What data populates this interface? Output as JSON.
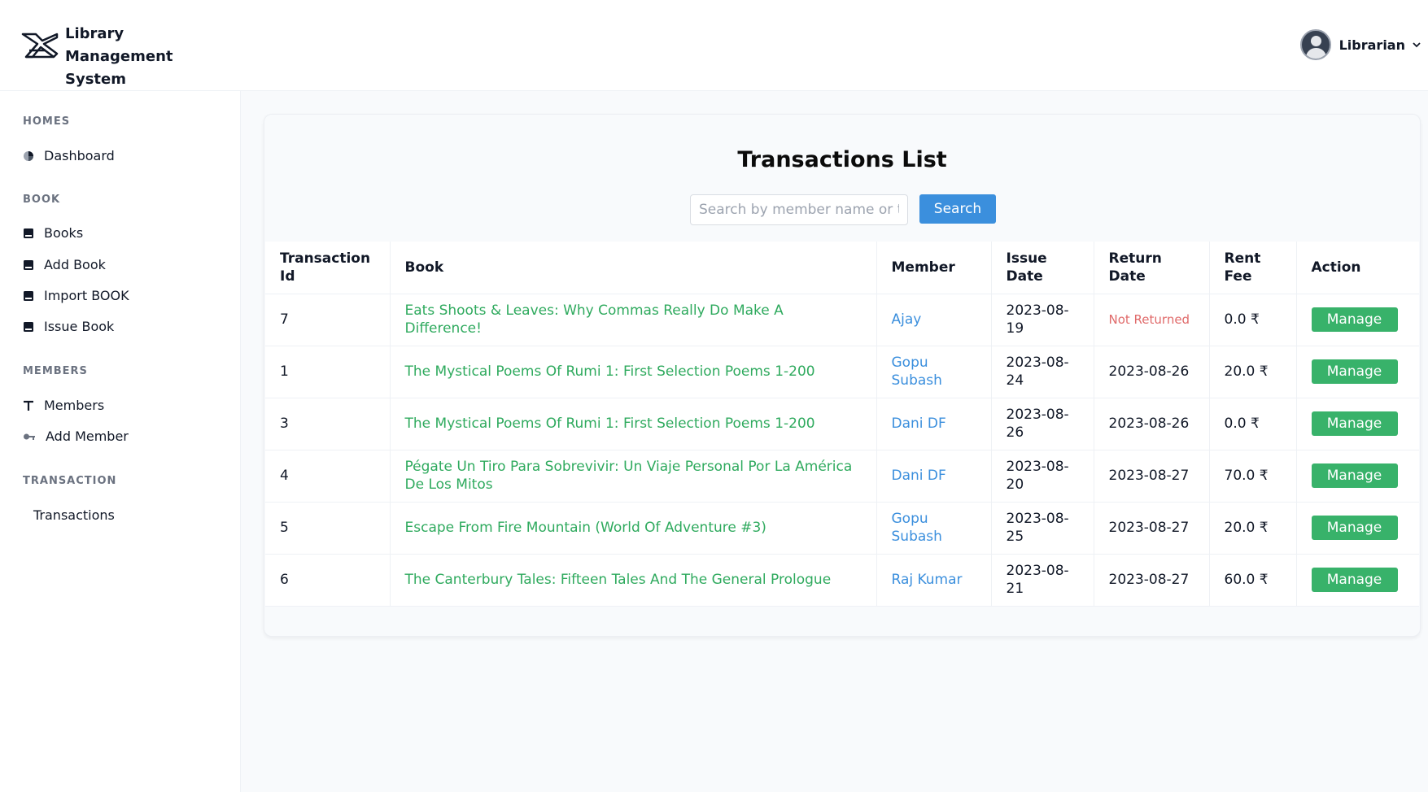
{
  "header": {
    "title": "Library Management System",
    "title_line1": "Library Management",
    "title_line2": "System",
    "logo_icon": "library-logo-icon",
    "user": {
      "name": "Librarian",
      "avatar_icon": "user-avatar-icon",
      "dropdown_icon": "chevron-down-icon"
    }
  },
  "sidebar": {
    "sections": [
      {
        "title": "HOMES",
        "items": [
          {
            "label": "Dashboard",
            "icon": "pie-chart-icon"
          }
        ]
      },
      {
        "title": "BOOK",
        "items": [
          {
            "label": "Books",
            "icon": "book-icon"
          },
          {
            "label": "Add Book",
            "icon": "book-icon"
          },
          {
            "label": "Import BOOK",
            "icon": "book-icon"
          },
          {
            "label": "Issue Book",
            "icon": "book-icon"
          }
        ]
      },
      {
        "title": "MEMBERS",
        "items": [
          {
            "label": "Members",
            "icon": "text-t-icon"
          },
          {
            "label": "Add Member",
            "icon": "key-icon"
          }
        ]
      },
      {
        "title": "TRANSACTION",
        "items": [
          {
            "label": "Transactions",
            "icon": ""
          }
        ]
      }
    ]
  },
  "main": {
    "title": "Transactions List",
    "search": {
      "placeholder": "Search by member name or tr",
      "button_label": "Search"
    },
    "table": {
      "headers": [
        "Transaction Id",
        "Book",
        "Member",
        "Issue Date",
        "Return Date",
        "Rent Fee",
        "Action"
      ],
      "rows": [
        {
          "id": "7",
          "book": "Eats Shoots & Leaves: Why Commas Really Do Make A Difference!",
          "member": "Ajay",
          "issue_date": "2023-08-19",
          "return_date": "Not Returned",
          "rent_fee": "0.0 ₹",
          "action": "Manage"
        },
        {
          "id": "1",
          "book": "The Mystical Poems Of Rumi 1: First Selection Poems 1-200",
          "member": "Gopu Subash",
          "issue_date": "2023-08-24",
          "return_date": "2023-08-26",
          "rent_fee": "20.0 ₹",
          "action": "Manage"
        },
        {
          "id": "3",
          "book": "The Mystical Poems Of Rumi 1: First Selection Poems 1-200",
          "member": "Dani DF",
          "issue_date": "2023-08-26",
          "return_date": "2023-08-26",
          "rent_fee": "0.0 ₹",
          "action": "Manage"
        },
        {
          "id": "4",
          "book": "Pégate Un Tiro Para Sobrevivir: Un Viaje Personal Por La América De Los Mitos",
          "member": "Dani DF",
          "issue_date": "2023-08-20",
          "return_date": "2023-08-27",
          "rent_fee": "70.0 ₹",
          "action": "Manage"
        },
        {
          "id": "5",
          "book": "Escape From Fire Mountain (World Of Adventure #3)",
          "member": "Gopu Subash",
          "issue_date": "2023-08-25",
          "return_date": "2023-08-27",
          "rent_fee": "20.0 ₹",
          "action": "Manage"
        },
        {
          "id": "6",
          "book": "The Canterbury Tales: Fifteen Tales And The General Prologue",
          "member": "Raj Kumar",
          "issue_date": "2023-08-21",
          "return_date": "2023-08-27",
          "rent_fee": "60.0 ₹",
          "action": "Manage"
        }
      ]
    }
  },
  "colors": {
    "accent_blue": "#3b8fdd",
    "book_green": "#2faa5e",
    "manage_green": "#38b26a",
    "not_returned_red": "#e06a6a"
  }
}
